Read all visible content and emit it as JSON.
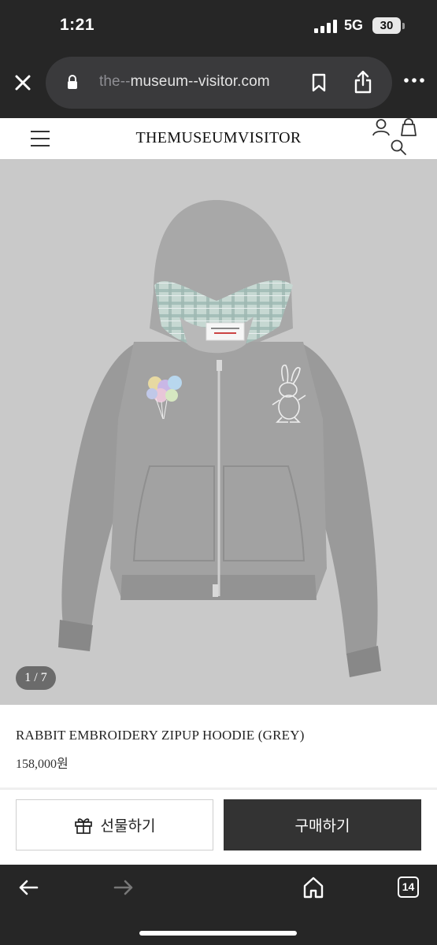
{
  "status_bar": {
    "time": "1:21",
    "network": "5G",
    "battery": "30"
  },
  "browser": {
    "url_prefix": "the--",
    "url_rest": "museum--visitor.com",
    "open_tabs": "14",
    "icons": [
      "close-icon",
      "lock-icon",
      "bookmark-icon",
      "share-icon",
      "more-icon",
      "back-arrow-icon",
      "forward-arrow-icon",
      "home-icon",
      "tabs-icon"
    ]
  },
  "site": {
    "brand": "THEMUSEUMVISITOR",
    "icons": [
      "menu-icon",
      "user-icon",
      "bag-icon",
      "search-icon"
    ]
  },
  "gallery": {
    "counter": "1 / 7"
  },
  "product": {
    "name": "RABBIT EMBROIDERY ZIPUP HOODIE (GREY)",
    "price": "158,000원"
  },
  "actions": {
    "gift_label": "선물하기",
    "buy_label": "구매하기"
  },
  "colors": {
    "buy_button_bg": "#333333",
    "image_bg": "#c9c9c9",
    "browser_chrome": "#262626"
  }
}
